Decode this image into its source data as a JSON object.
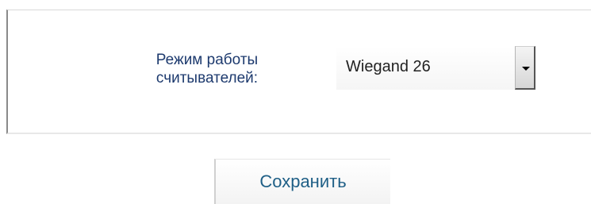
{
  "form": {
    "label": "Режим работы\nсчитывателей:",
    "select": {
      "value": "Wiegand 26"
    }
  },
  "actions": {
    "save_label": "Сохранить"
  }
}
